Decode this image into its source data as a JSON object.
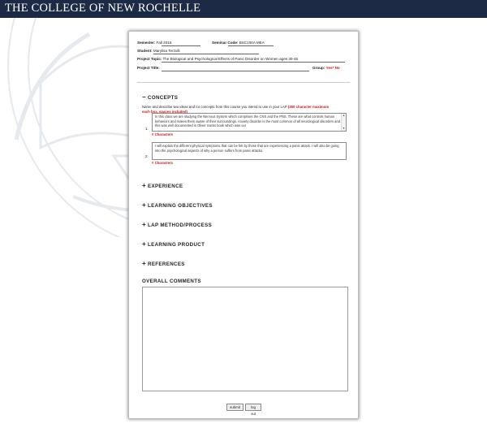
{
  "header": {
    "brand": "THE COLLEGE OF NEW ROCHELLE"
  },
  "form": {
    "semester_label": "Semester:",
    "semester_value": "Fall 2015",
    "seminar_code_label": "Seminar Code:",
    "seminar_code_value": "BSC100A MEA",
    "student_label": "Student:",
    "student_value": "Marylisa Terzulli",
    "project_topic_label": "Project Topic:",
    "project_topic_value": "The Biological and Psychological Effects of Panic Disorder on Women ages 30-45",
    "project_title_label": "Project Title:",
    "project_title_value": "",
    "group_label": "Group:",
    "group_value": "Yes* No"
  },
  "concepts": {
    "title": "CONCEPTS",
    "toggle": "−",
    "instructions_main": "Name and describe two ideas and /or concepts from this course you intend to use in your LAP",
    "instructions_note": "(350 character maximum each box, spaces included)",
    "item1_number": "1.",
    "item1_text": "In this class we are studying the Nervous System which comprises the CNS and the PNS.  These are what controls human behaviors and makes them aware of their surroundings.  Anxiety disorder is the most common of all neurological disorders and this was well documented in Oliver Sacks book which was our",
    "item1_chars": "# Characters",
    "item2_number": "2.",
    "item2_text": "I will explain the different physical symptoms that can be felt by those that are experiencing a panic attack.  I will also be going into the psychological aspects of why a person suffers from panic attacks.",
    "item2_chars": "# Characters"
  },
  "sections": [
    {
      "label": "EXPERIENCE",
      "toggle": "+"
    },
    {
      "label": "LEARNING OBJECTIVES",
      "toggle": "+"
    },
    {
      "label": "LAP METHOD/PROCESS",
      "toggle": "+"
    },
    {
      "label": "LEARNING PRODUCT",
      "toggle": "+"
    },
    {
      "label": "REFERENCES",
      "toggle": "+"
    }
  ],
  "overall": {
    "title": "OVERALL COMMENTS",
    "value": ""
  },
  "buttons": {
    "submit": "submit",
    "logout": "log out"
  }
}
